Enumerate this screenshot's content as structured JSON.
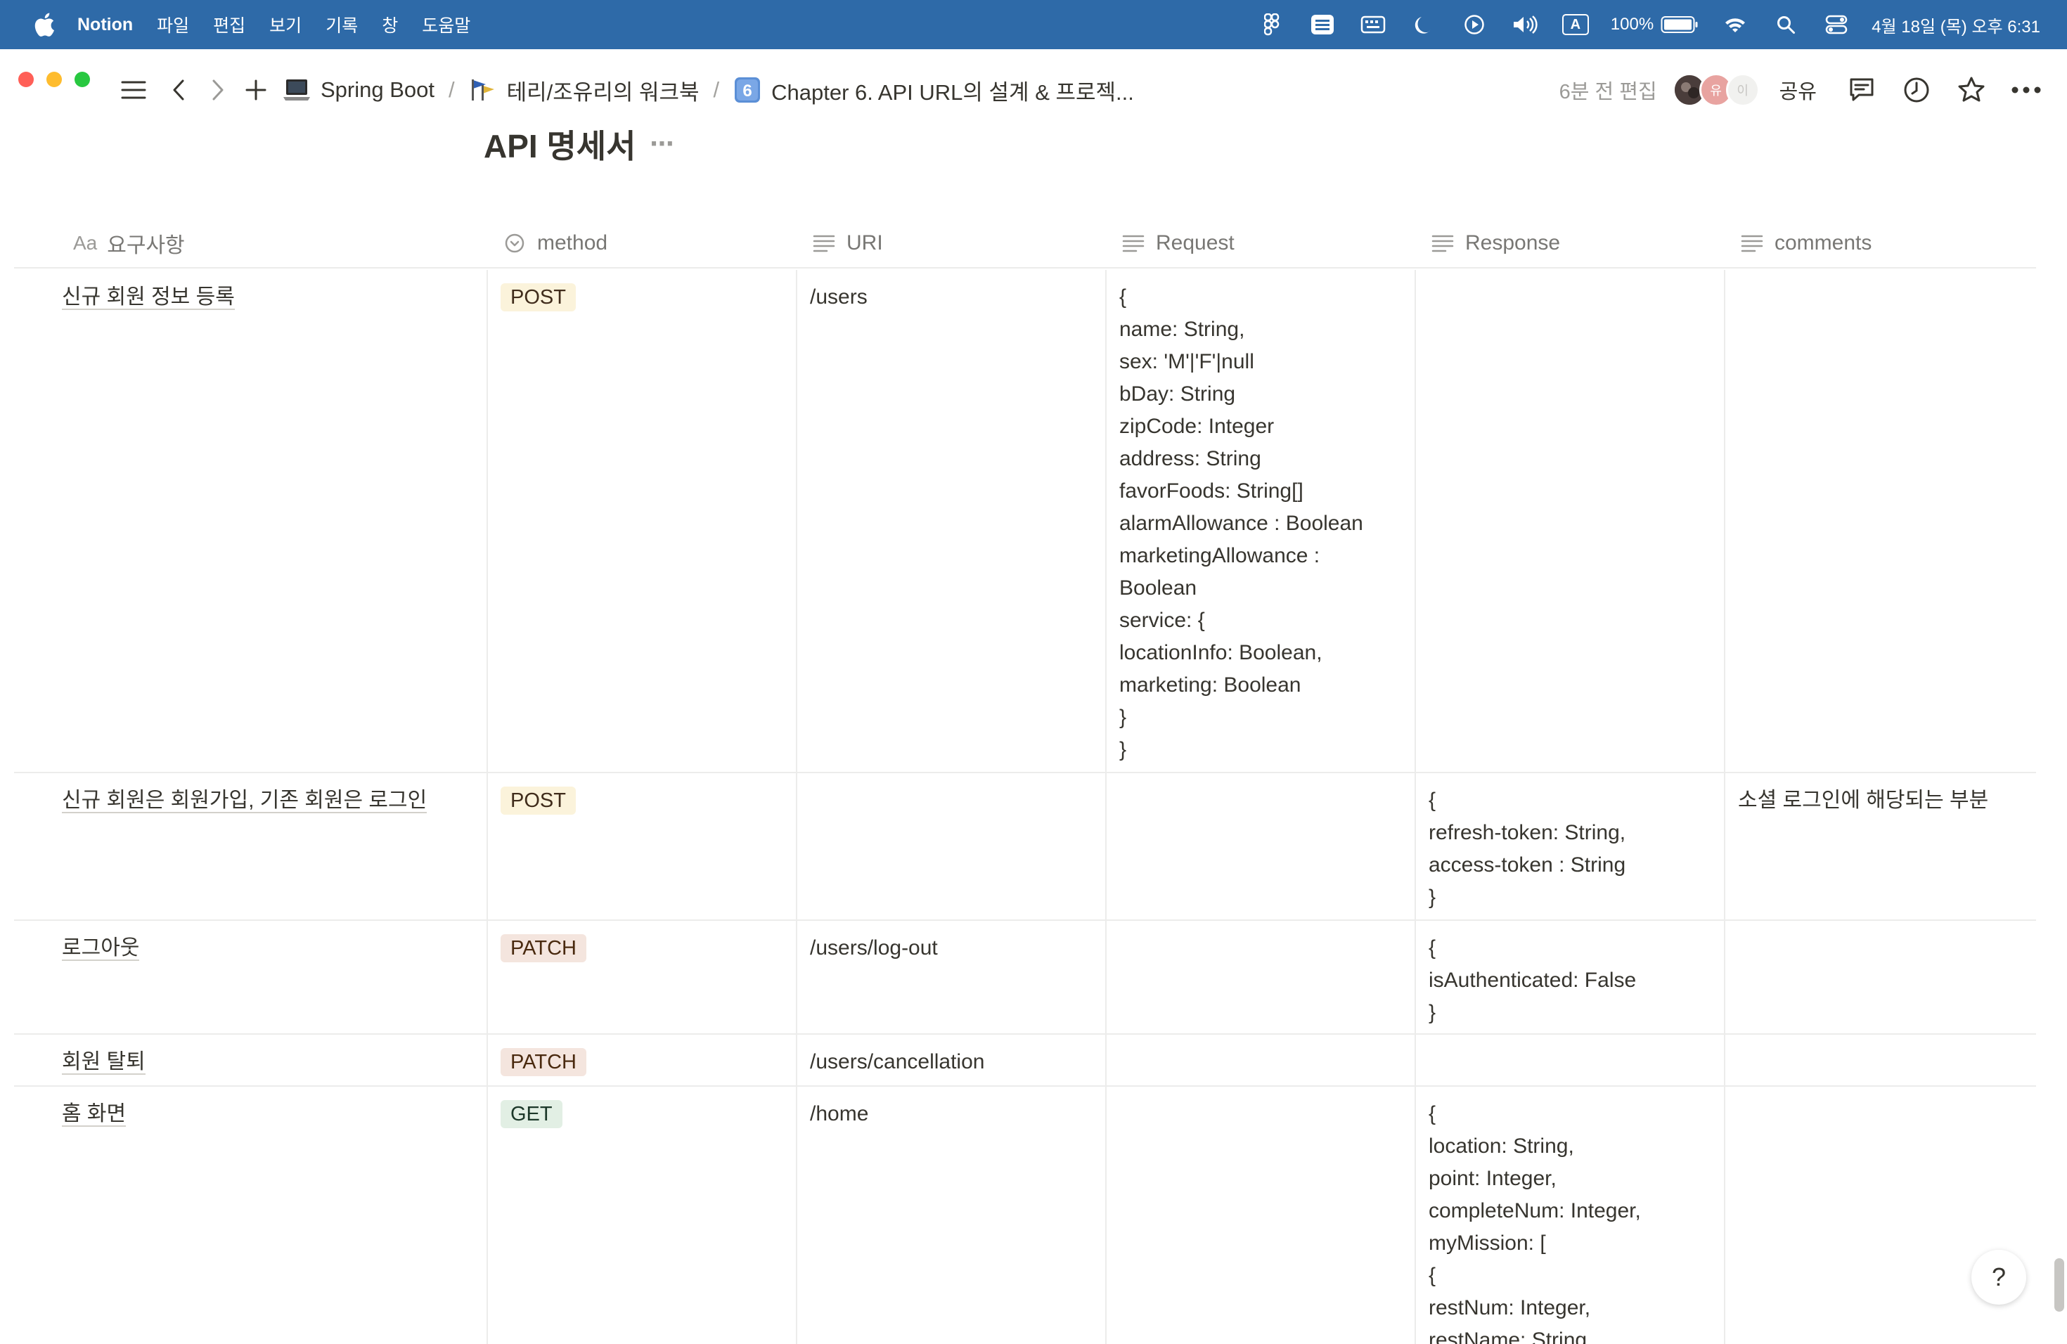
{
  "menubar": {
    "app": "Notion",
    "items": [
      "파일",
      "편집",
      "보기",
      "기록",
      "창",
      "도움말"
    ],
    "battery": "100%",
    "datetime": "4월 18일 (목) 오후 6:31",
    "input_indicator": "A"
  },
  "titlebar": {
    "breadcrumb": [
      {
        "label": "Spring Boot",
        "icon": "laptop-icon"
      },
      {
        "label": "테리/조유리의 워크북",
        "icon": "flag-icon"
      },
      {
        "label": "Chapter 6. API URL의 설계 & 프로젝...",
        "icon": "keycap-6-icon"
      }
    ],
    "breadcrumb_sep": "/",
    "edited": "6분 전 편집",
    "avatar_labels": [
      "유",
      "이"
    ],
    "share": "공유"
  },
  "database": {
    "title": "API 명세서",
    "columns": [
      {
        "label": "요구사항",
        "icon_text": "Aa"
      },
      {
        "label": "method"
      },
      {
        "label": "URI"
      },
      {
        "label": "Request"
      },
      {
        "label": "Response"
      },
      {
        "label": "comments"
      }
    ],
    "rows": [
      {
        "name": "신규 회원 정보 등록",
        "method": "POST",
        "uri": "/users",
        "request": [
          "{",
          "name: String,",
          "sex: 'M'|'F'|null",
          "bDay: String",
          "zipCode: Integer",
          "address: String",
          "favorFoods: String[]",
          "alarmAllowance : Boolean",
          "marketingAllowance :",
          "Boolean",
          "service: {",
          "locationInfo: Boolean,",
          "marketing: Boolean",
          "}",
          "}"
        ],
        "response": [],
        "comments": ""
      },
      {
        "name": "신규 회원은 회원가입, 기존 회원은 로그인",
        "method": "POST",
        "uri": "",
        "request": [],
        "response": [
          "{",
          "refresh-token: String,",
          "access-token : String",
          "}"
        ],
        "comments": "소셜 로그인에 해당되는 부분"
      },
      {
        "name": "로그아웃",
        "method": "PATCH",
        "uri": "/users/log-out",
        "request": [],
        "response": [
          "{",
          "isAuthenticated: False",
          "}"
        ],
        "comments": ""
      },
      {
        "name": "회원 탈퇴",
        "method": "PATCH",
        "uri": "/users/cancellation",
        "request": [],
        "response": [],
        "comments": ""
      },
      {
        "name": "홈 화면",
        "method": "GET",
        "uri": "/home",
        "request": [],
        "response": [
          "{",
          "location: String,",
          "point: Integer,",
          "completeNum: Integer,",
          "myMission: [",
          "{",
          "restNum: Integer,",
          "restName: String,"
        ],
        "comments": ""
      }
    ]
  },
  "help_label": "?",
  "colors": {
    "menubar_bg": "#2e6aa8",
    "tag_post": "#fbf3db",
    "tag_patch": "#f4e5de",
    "tag_get": "#e2efe4"
  }
}
